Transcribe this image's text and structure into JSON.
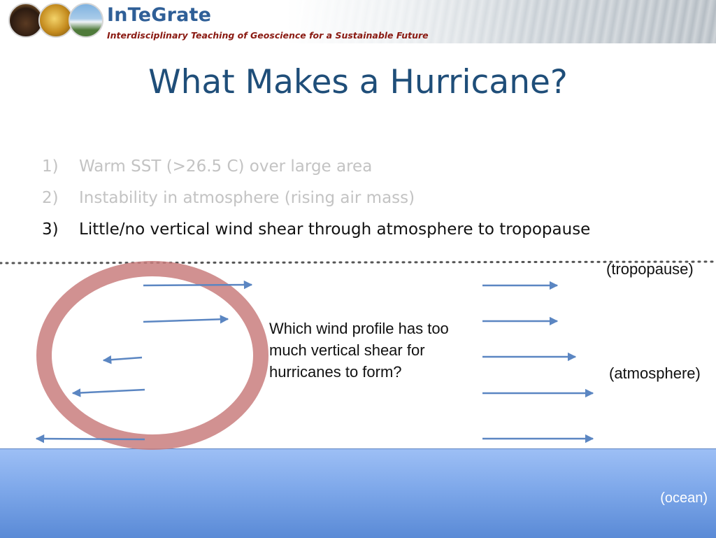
{
  "header": {
    "brand": "InTeGrate",
    "tagline": "Interdisciplinary Teaching of Geoscience for a Sustainable Future"
  },
  "slide": {
    "title": "What Makes a Hurricane?",
    "items": [
      {
        "num": "1)",
        "text": "Warm SST (>26.5 C) over large area",
        "state": "faded"
      },
      {
        "num": "2)",
        "text": "Instability in atmosphere (rising air mass)",
        "state": "faded"
      },
      {
        "num": "3)",
        "text": "Little/no vertical wind shear through atmosphere to tropopause",
        "state": "active"
      }
    ]
  },
  "diagram": {
    "tropopause_label": "(tropopause)",
    "atmosphere_label": "(atmosphere)",
    "ocean_label": "(ocean)",
    "question": "Which wind profile has too much vertical shear for hurricanes to form?",
    "colors": {
      "arrow": "#5b86c2",
      "circle": "#c97e7e",
      "ocean": "#7ea8ea",
      "title": "#1f4e79"
    }
  }
}
